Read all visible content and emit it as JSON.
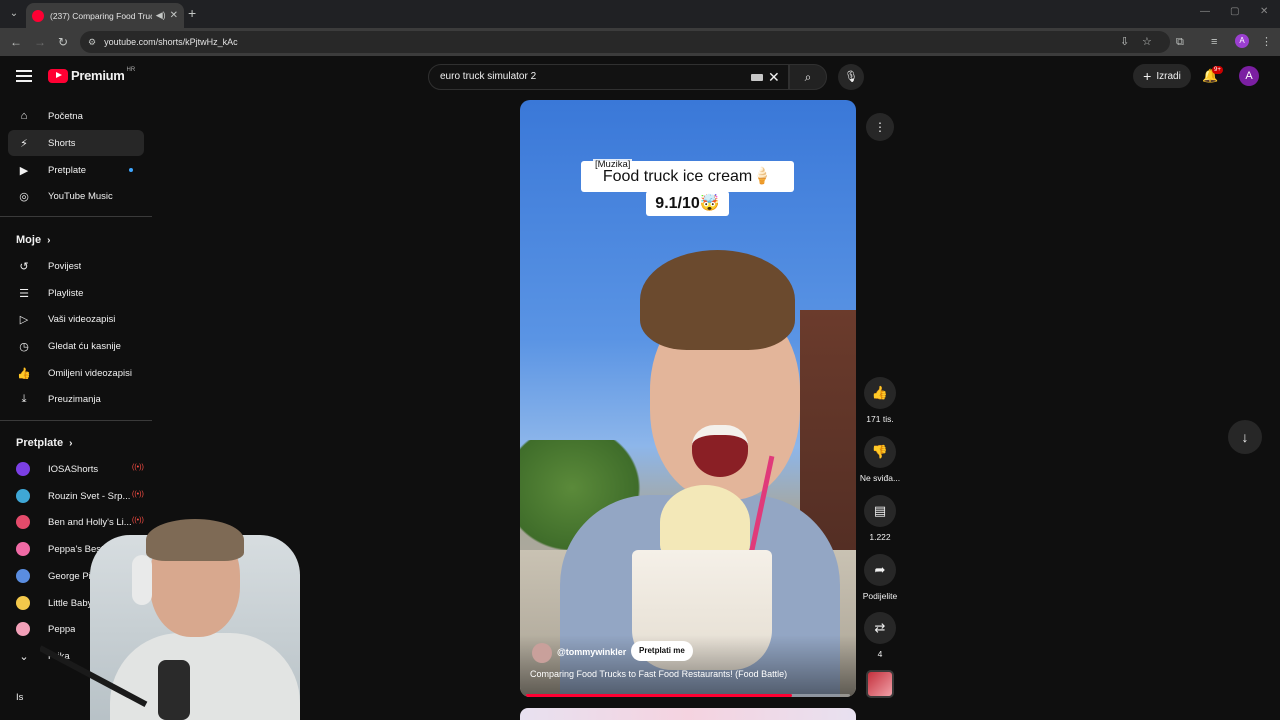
{
  "browser": {
    "tab_title": "(237) Comparing Food Truc",
    "url": "youtube.com/shorts/kPjtwHz_kAc",
    "profile_initial": "A"
  },
  "header": {
    "brand": "Premium",
    "region": "HR",
    "search_query": "euro truck simulator 2",
    "create_label": "Izradi",
    "notif_badge": "9+",
    "avatar_initial": "A"
  },
  "sidebar": {
    "main": [
      {
        "label": "Početna",
        "icon": "home-icon"
      },
      {
        "label": "Shorts",
        "icon": "shorts-icon"
      },
      {
        "label": "Pretplate",
        "icon": "subscriptions-icon"
      },
      {
        "label": "YouTube Music",
        "icon": "music-icon"
      }
    ],
    "you_heading": "Moje",
    "you": [
      {
        "label": "Povijest",
        "icon": "history-icon"
      },
      {
        "label": "Playliste",
        "icon": "playlist-icon"
      },
      {
        "label": "Vaši videozapisi",
        "icon": "your-videos-icon"
      },
      {
        "label": "Gledat ću kasnije",
        "icon": "watch-later-icon"
      },
      {
        "label": "Omiljeni videozapisi",
        "icon": "liked-icon"
      },
      {
        "label": "Preuzimanja",
        "icon": "download-icon"
      }
    ],
    "subs_heading": "Pretplate",
    "subs": [
      {
        "label": "IOSAShorts",
        "color": "#7b3fe4"
      },
      {
        "label": "Rouzin Svet - Srp...",
        "color": "#3fa7d6"
      },
      {
        "label": "Ben and Holly's Li...",
        "color": "#e44b6b"
      },
      {
        "label": "Peppa's Best Bites",
        "color": "#f06aa5"
      },
      {
        "label": "George Pig",
        "color": "#5a8de0"
      },
      {
        "label": "Little Baby",
        "color": "#f3c84b"
      },
      {
        "label": "Peppa",
        "color": "#f2a0b8"
      }
    ],
    "show_more": "Prika",
    "bottom_item": "Is"
  },
  "short": {
    "tag": "[Muzika]",
    "caption1": "Food truck ice cream🍦",
    "caption2": "9.1/10🤯",
    "handle": "@tommywinkler",
    "subscribe_label": "Pretplati me",
    "title": "Comparing Food Trucks to Fast Food Restaurants! (Food Battle)",
    "progress": 0.82
  },
  "actions": {
    "likes": "171 tis.",
    "dislike": "Ne sviđa...",
    "comments": "1.222",
    "share": "Podijelite",
    "remix": "4"
  }
}
